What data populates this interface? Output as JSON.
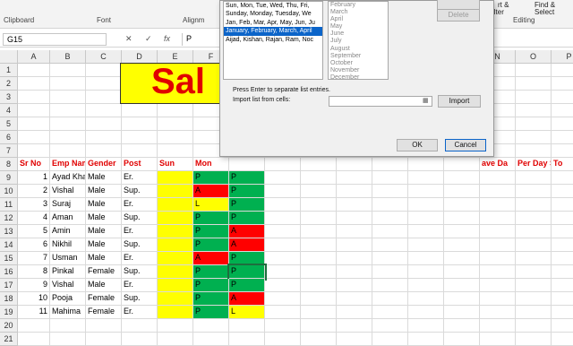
{
  "ribbon": {
    "clipboard": "Clipboard",
    "font": "Font",
    "alignment": "Alignm",
    "editing": "Editing",
    "sort_filter": "rt &",
    "find": "Find &",
    "filter": "ilter",
    "select": "Select"
  },
  "formula_bar": {
    "name_box": "G15",
    "value": "P"
  },
  "columns": [
    "A",
    "B",
    "C",
    "D",
    "E",
    "F",
    "G",
    "H",
    "I",
    "J",
    "K",
    "L",
    "M",
    "N",
    "O",
    "P"
  ],
  "rows": [
    "1",
    "2",
    "3",
    "4",
    "5",
    "6",
    "7",
    "8",
    "9",
    "10",
    "11",
    "12",
    "13",
    "14",
    "15",
    "16",
    "17",
    "18",
    "19",
    "20",
    "21"
  ],
  "title_text": "Sal",
  "headers": {
    "sr": "Sr No",
    "emp": "Emp Nam",
    "gender": "Gender",
    "post": "Post",
    "sun": "Sun",
    "mon": "Mon",
    "leave": "ave Da",
    "perday": "Per Day S",
    "total": "To"
  },
  "table": [
    {
      "sr": "1",
      "name": "Ayad Khar",
      "gender": "Male",
      "post": "Er.",
      "mon": "P",
      "tue": "P"
    },
    {
      "sr": "2",
      "name": "Vishal",
      "gender": "Male",
      "post": "Sup.",
      "mon": "A",
      "tue": "P"
    },
    {
      "sr": "3",
      "name": "Suraj",
      "gender": "Male",
      "post": "Er.",
      "mon": "L",
      "tue": "P"
    },
    {
      "sr": "4",
      "name": "Aman",
      "gender": "Male",
      "post": "Sup.",
      "mon": "P",
      "tue": "P"
    },
    {
      "sr": "5",
      "name": "Amin",
      "gender": "Male",
      "post": "Er.",
      "mon": "P",
      "tue": "A"
    },
    {
      "sr": "6",
      "name": "Nikhil",
      "gender": "Male",
      "post": "Sup.",
      "mon": "P",
      "tue": "A"
    },
    {
      "sr": "7",
      "name": "Usman",
      "gender": "Male",
      "post": "Er.",
      "mon": "A",
      "tue": "P"
    },
    {
      "sr": "8",
      "name": "Pinkal",
      "gender": "Female",
      "post": "Sup.",
      "mon": "P",
      "tue": "P"
    },
    {
      "sr": "9",
      "name": "Vishal",
      "gender": "Male",
      "post": "Er.",
      "mon": "P",
      "tue": "P"
    },
    {
      "sr": "10",
      "name": "Pooja",
      "gender": "Female",
      "post": "Sup.",
      "mon": "P",
      "tue": "A"
    },
    {
      "sr": "11",
      "name": "Mahima",
      "gender": "Female",
      "post": "Er.",
      "mon": "P",
      "tue": "L"
    }
  ],
  "dialog": {
    "custom_lists": [
      "Sun, Mon, Tue, Wed, Thu, Fri,",
      "Sunday, Monday, Tuesday, We",
      "Jan, Feb, Mar, Apr, May, Jun, Ju",
      "January, February, March, April",
      "Aijad, Kishan, Rajan, Ram, Noc"
    ],
    "selected_index": 3,
    "entries": [
      "February",
      "March",
      "April",
      "May",
      "June",
      "July",
      "August",
      "September",
      "October",
      "November",
      "December"
    ],
    "hint": "Press Enter to separate list entries.",
    "import_label": "Import list from cells:",
    "import_button": "Import",
    "delete_button": "Delete",
    "ok_button": "OK",
    "cancel_button": "Cancel"
  },
  "colors": {
    "yellow": "#ffff00",
    "green": "#00b050",
    "red": "#ff0000",
    "header_red": "#e00000",
    "selection_blue": "#0b64c9"
  }
}
